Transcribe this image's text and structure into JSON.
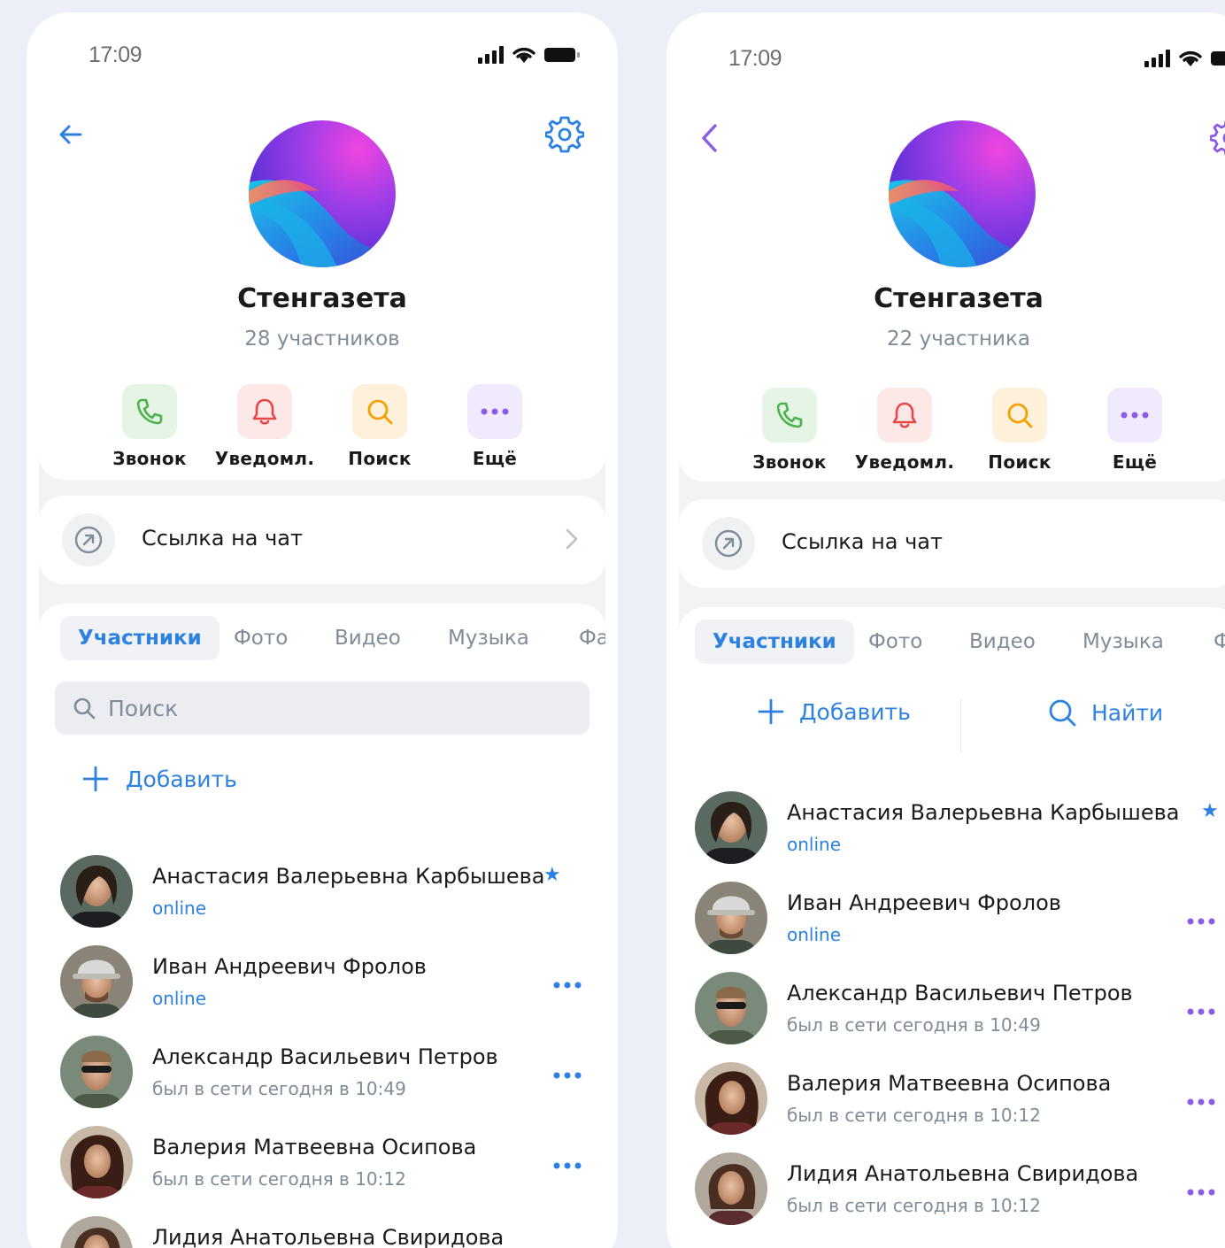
{
  "colors": {
    "accent": "#2d81e0",
    "call": "#4bb34b",
    "notify": "#e64646",
    "search": "#f5a000",
    "more": "#8a5ce6"
  },
  "screens": [
    {
      "status": {
        "time": "17:09"
      },
      "header": {
        "title": "Стенгазета",
        "subtitle": "28 участников"
      },
      "actions": [
        {
          "label": "Звонок",
          "icon": "phone-icon"
        },
        {
          "label": "Уведомл.",
          "icon": "bell-icon"
        },
        {
          "label": "Поиск",
          "icon": "search-icon"
        },
        {
          "label": "Ещё",
          "icon": "more-dots-icon"
        }
      ],
      "link": {
        "label": "Ссылка на чат"
      },
      "tabs": [
        "Участники",
        "Фото",
        "Видео",
        "Музыка",
        "Фа"
      ],
      "search": {
        "placeholder": "Поиск",
        "value": ""
      },
      "add_label": "Добавить",
      "members": [
        {
          "name": "Анастасия Валерьевна Карбышева",
          "status": "online",
          "star": "★"
        },
        {
          "name": "Иван Андреевич Фролов",
          "status": "online"
        },
        {
          "name": "Александр Васильевич Петров",
          "status": "был в сети сегодня в 10:49"
        },
        {
          "name": "Валерия Матвеевна Осипова",
          "status": "был в сети сегодня в 10:12"
        },
        {
          "name": "Лидия Анатольевна Свиридова",
          "status": ""
        }
      ]
    },
    {
      "status": {
        "time": "17:09"
      },
      "header": {
        "title": "Стенгазета",
        "subtitle": "22 участника"
      },
      "actions": [
        {
          "label": "Звонок",
          "icon": "phone-icon"
        },
        {
          "label": "Уведомл.",
          "icon": "bell-icon"
        },
        {
          "label": "Поиск",
          "icon": "search-icon"
        },
        {
          "label": "Ещё",
          "icon": "more-dots-icon"
        }
      ],
      "link": {
        "label": "Ссылка на чат"
      },
      "tabs": [
        "Участники",
        "Фото",
        "Видео",
        "Музыка",
        "Ф"
      ],
      "add_label": "Добавить",
      "find_label": "Найти",
      "members": [
        {
          "name": "Анастасия Валерьевна Карбышева",
          "status": "online",
          "star": "★"
        },
        {
          "name": "Иван Андреевич Фролов",
          "status": "online"
        },
        {
          "name": "Александр Васильевич Петров",
          "status": "был в сети сегодня в 10:49"
        },
        {
          "name": "Валерия Матвеевна Осипова",
          "status": "был в сети сегодня в 10:12"
        },
        {
          "name": "Лидия Анатольевна Свиридова",
          "status": "был в сети сегодня в 10:12"
        }
      ]
    }
  ]
}
